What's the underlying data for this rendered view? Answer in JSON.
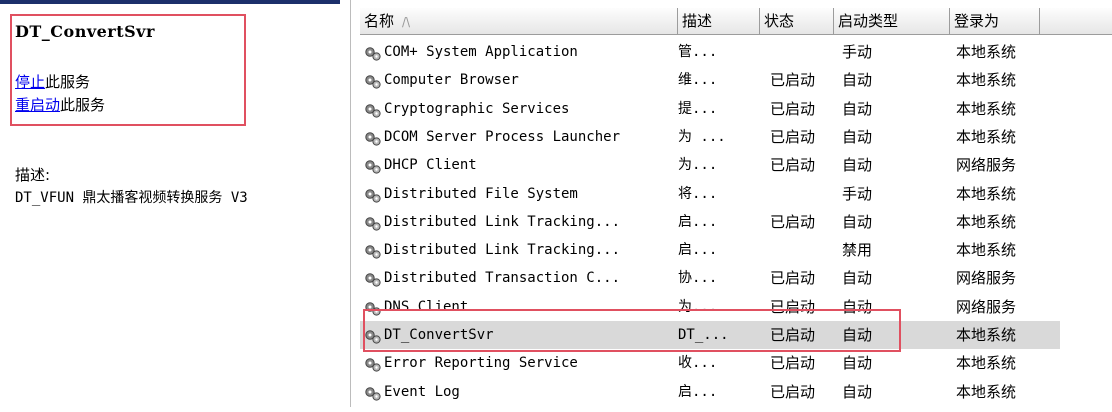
{
  "service": {
    "name": "DT_ConvertSvr",
    "stop_link": "停止",
    "stop_suffix": "此服务",
    "restart_link": "重启动",
    "restart_suffix": "此服务",
    "description_label": "描述:",
    "description_text": "DT_VFUN 鼎太播客视频转换服务 V3"
  },
  "columns": {
    "name": "名称",
    "description": "描述",
    "status": "状态",
    "startup_type": "启动类型",
    "logon_as": "登录为"
  },
  "rows": [
    {
      "name": "COM+ System Application",
      "desc": "管...",
      "status": "",
      "startup": "手动",
      "logon": "本地系统"
    },
    {
      "name": "Computer Browser",
      "desc": "维...",
      "status": "已启动",
      "startup": "自动",
      "logon": "本地系统"
    },
    {
      "name": "Cryptographic Services",
      "desc": "提...",
      "status": "已启动",
      "startup": "自动",
      "logon": "本地系统"
    },
    {
      "name": "DCOM Server Process Launcher",
      "desc": "为 ...",
      "status": "已启动",
      "startup": "自动",
      "logon": "本地系统"
    },
    {
      "name": "DHCP Client",
      "desc": "为...",
      "status": "已启动",
      "startup": "自动",
      "logon": "网络服务"
    },
    {
      "name": "Distributed File System",
      "desc": "将...",
      "status": "",
      "startup": "手动",
      "logon": "本地系统"
    },
    {
      "name": "Distributed Link Tracking...",
      "desc": "启...",
      "status": "已启动",
      "startup": "自动",
      "logon": "本地系统"
    },
    {
      "name": "Distributed Link Tracking...",
      "desc": "启...",
      "status": "",
      "startup": "禁用",
      "logon": "本地系统"
    },
    {
      "name": "Distributed Transaction C...",
      "desc": "协...",
      "status": "已启动",
      "startup": "自动",
      "logon": "网络服务"
    },
    {
      "name": "DNS Client",
      "desc": "为...",
      "status": "已启动",
      "startup": "自动",
      "logon": "网络服务"
    },
    {
      "name": "DT_ConvertSvr",
      "desc": "DT_...",
      "status": "已启动",
      "startup": "自动",
      "logon": "本地系统",
      "selected": true
    },
    {
      "name": "Error Reporting Service",
      "desc": "收...",
      "status": "已启动",
      "startup": "自动",
      "logon": "本地系统"
    },
    {
      "name": "Event Log",
      "desc": "启...",
      "status": "已启动",
      "startup": "自动",
      "logon": "本地系统"
    }
  ],
  "colors": {
    "highlight_box": "#e05060",
    "selected_row": "#d9d9d9",
    "link": "#0000ee"
  }
}
